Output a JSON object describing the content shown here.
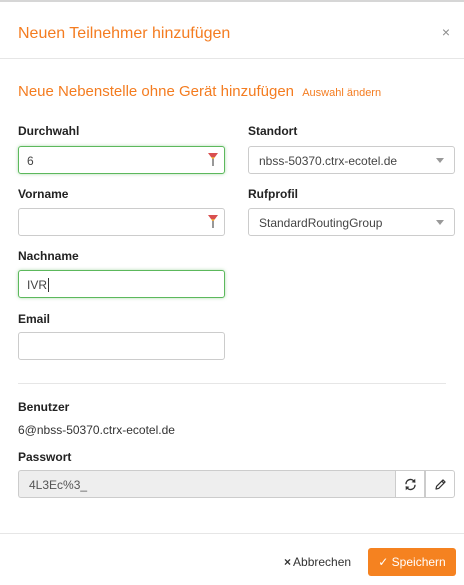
{
  "dialog": {
    "title": "Neuen Teilnehmer hinzufügen",
    "close_glyph": "×",
    "subtitle": "Neue Nebenstelle ohne Gerät hinzufügen",
    "change_selection_link": "Auswahl ändern"
  },
  "form": {
    "durchwahl": {
      "label": "Durchwahl",
      "value": "6"
    },
    "vorname": {
      "label": "Vorname",
      "value": ""
    },
    "nachname": {
      "label": "Nachname",
      "value": "IVR"
    },
    "email": {
      "label": "Email",
      "value": ""
    },
    "standort": {
      "label": "Standort",
      "selected": "nbss-50370.ctrx-ecotel.de"
    },
    "rufprofil": {
      "label": "Rufprofil",
      "selected": "StandardRoutingGroup"
    }
  },
  "account": {
    "benutzer_label": "Benutzer",
    "benutzer_value": "6@nbss-50370.ctrx-ecotel.de",
    "passwort_label": "Passwort",
    "passwort_value": "4L3Ec%3_"
  },
  "footer": {
    "cancel_label": "Abbrechen",
    "cancel_icon": "×",
    "save_label": "Speichern",
    "save_icon": "✓"
  },
  "icons": {
    "field_marker": "flag-icon",
    "refresh": "refresh-icon",
    "edit": "pencil-icon"
  },
  "colors": {
    "accent": "#f47c20",
    "save_button": "#f58220",
    "focus_border": "#5cb85c"
  }
}
